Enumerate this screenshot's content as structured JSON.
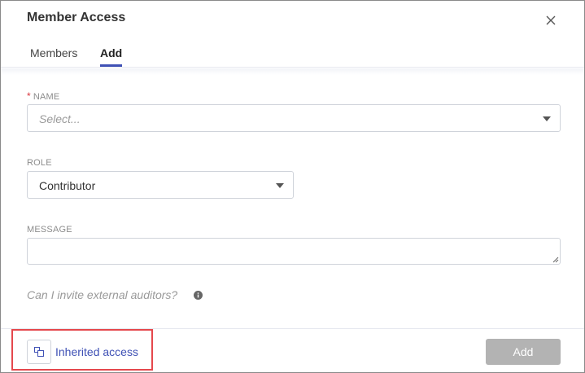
{
  "dialog": {
    "title": "Member Access"
  },
  "tabs": [
    {
      "label": "Members",
      "active": false
    },
    {
      "label": "Add",
      "active": true
    }
  ],
  "form": {
    "name": {
      "label": "NAME",
      "required_marker": "*",
      "placeholder": "Select..."
    },
    "role": {
      "label": "ROLE",
      "value": "Contributor"
    },
    "message": {
      "label": "MESSAGE",
      "value": ""
    },
    "help_text": "Can I invite external auditors?"
  },
  "footer": {
    "inherited_access_label": "Inherited access",
    "add_label": "Add"
  },
  "icons": {
    "close": "close-icon",
    "dropdown": "chevron-down-icon",
    "info": "info-icon",
    "inherited": "inherited-access-icon"
  },
  "colors": {
    "accent": "#3f51b5",
    "required": "#d9363e",
    "highlight": "#e5484d",
    "disabled_button": "#b3b3b3"
  }
}
